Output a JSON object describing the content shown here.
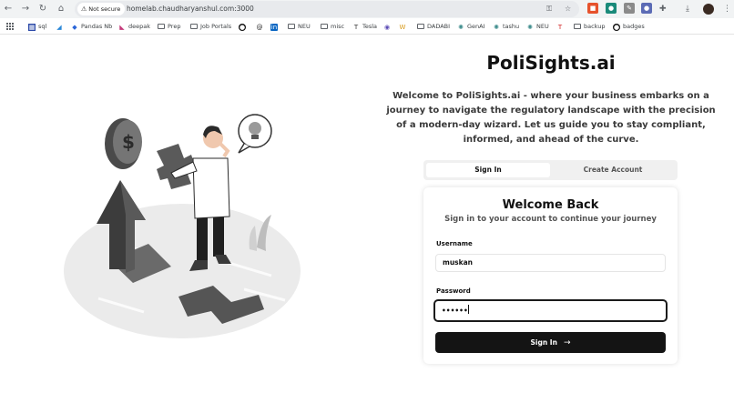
{
  "browser": {
    "security_label": "Not secure",
    "url": "homelab.chaudharyanshul.com:3000"
  },
  "bookmarks": [
    {
      "label": "sql",
      "icon": "sql-icon"
    },
    {
      "label": "",
      "icon": "vscode-icon"
    },
    {
      "label": "Pandas Nb",
      "icon": "pandas-icon"
    },
    {
      "label": "deepak",
      "icon": "deepak-icon"
    },
    {
      "label": "Prep",
      "icon": "folder-icon"
    },
    {
      "label": "Job Portals",
      "icon": "folder-icon"
    },
    {
      "label": "",
      "icon": "github-icon"
    },
    {
      "label": "",
      "icon": "threads-icon"
    },
    {
      "label": "",
      "icon": "linkedin-icon"
    },
    {
      "label": "NEU",
      "icon": "folder-icon"
    },
    {
      "label": "misc",
      "icon": "folder-icon"
    },
    {
      "label": "Tesla",
      "icon": "tesla-icon"
    },
    {
      "label": "",
      "icon": "circle-icon"
    },
    {
      "label": "",
      "icon": "w-icon"
    },
    {
      "label": "DADABI",
      "icon": "folder-icon"
    },
    {
      "label": "GenAI",
      "icon": "gear-icon"
    },
    {
      "label": "tashu",
      "icon": "gear-icon"
    },
    {
      "label": "NEU",
      "icon": "gear-icon"
    },
    {
      "label": "",
      "icon": "tesla-red-icon"
    },
    {
      "label": "backup",
      "icon": "folder-icon"
    },
    {
      "label": "badges",
      "icon": "github-icon"
    }
  ],
  "page": {
    "brand": "PoliSights.ai",
    "intro": "Welcome to PoliSights.ai - where your business embarks on a journey to navigate the regulatory landscape with the precision of a modern-day wizard. Let us guide you to stay compliant, informed, and ahead of the curve.",
    "tabs": {
      "signin": "Sign In",
      "create": "Create Account"
    },
    "card": {
      "title": "Welcome Back",
      "subtitle": "Sign in to your account to continue your journey",
      "username_label": "Username",
      "username_value": "muskan",
      "password_label": "Password",
      "password_mask": "••••••",
      "submit": "Sign In"
    }
  },
  "colors": {
    "accent": "#141414",
    "chrome": "#f1f3f4"
  }
}
